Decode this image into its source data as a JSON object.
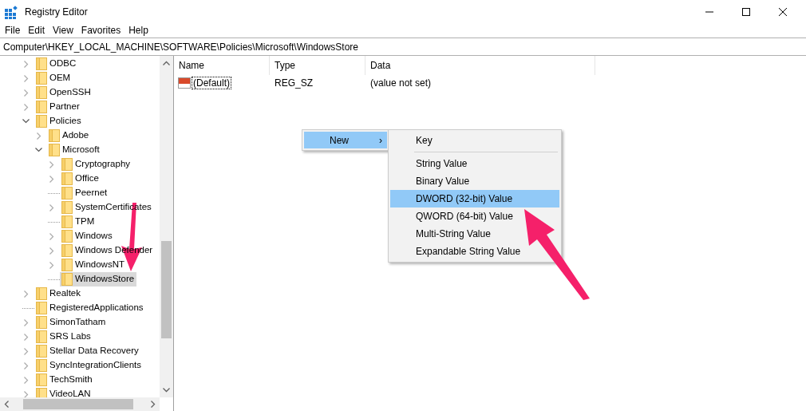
{
  "window": {
    "title": "Registry Editor"
  },
  "menu_bar": [
    "File",
    "Edit",
    "View",
    "Favorites",
    "Help"
  ],
  "address_bar": {
    "value": "Computer\\HKEY_LOCAL_MACHINE\\SOFTWARE\\Policies\\Microsoft\\WindowsStore"
  },
  "tree": [
    {
      "label": "ODBC",
      "has_children": true,
      "expanded": false,
      "selected": false
    },
    {
      "label": "OEM",
      "has_children": true,
      "expanded": false,
      "selected": false
    },
    {
      "label": "OpenSSH",
      "has_children": true,
      "expanded": false,
      "selected": false
    },
    {
      "label": "Partner",
      "has_children": true,
      "expanded": false,
      "selected": false
    },
    {
      "label": "Policies",
      "has_children": true,
      "expanded": true,
      "selected": false,
      "children": [
        {
          "label": "Adobe",
          "has_children": true,
          "expanded": false,
          "selected": false
        },
        {
          "label": "Microsoft",
          "has_children": true,
          "expanded": true,
          "selected": false,
          "children": [
            {
              "label": "Cryptography",
              "has_children": true,
              "expanded": false,
              "selected": false
            },
            {
              "label": "Office",
              "has_children": true,
              "expanded": false,
              "selected": false
            },
            {
              "label": "Peernet",
              "has_children": false,
              "selected": false
            },
            {
              "label": "SystemCertificates",
              "has_children": true,
              "expanded": false,
              "selected": false
            },
            {
              "label": "TPM",
              "has_children": false,
              "selected": false
            },
            {
              "label": "Windows",
              "has_children": true,
              "expanded": false,
              "selected": false
            },
            {
              "label": "Windows Defender",
              "has_children": true,
              "expanded": false,
              "selected": false
            },
            {
              "label": "WindowsNT",
              "has_children": true,
              "expanded": false,
              "selected": false
            },
            {
              "label": "WindowsStore",
              "has_children": false,
              "selected": true
            }
          ]
        }
      ]
    },
    {
      "label": "Realtek",
      "has_children": true,
      "expanded": false,
      "selected": false
    },
    {
      "label": "RegisteredApplications",
      "has_children": false,
      "selected": false
    },
    {
      "label": "SimonTatham",
      "has_children": true,
      "expanded": false,
      "selected": false
    },
    {
      "label": "SRS Labs",
      "has_children": true,
      "expanded": false,
      "selected": false
    },
    {
      "label": "Stellar Data Recovery",
      "has_children": true,
      "expanded": false,
      "selected": false
    },
    {
      "label": "SyncIntegrationClients",
      "has_children": true,
      "expanded": false,
      "selected": false
    },
    {
      "label": "TechSmith",
      "has_children": true,
      "expanded": false,
      "selected": false
    },
    {
      "label": "VideoLAN",
      "has_children": true,
      "expanded": false,
      "selected": false
    }
  ],
  "values_table": {
    "columns": [
      "Name",
      "Type",
      "Data"
    ],
    "rows": [
      {
        "name": "(Default)",
        "type": "REG_SZ",
        "data": "(value not set)"
      }
    ]
  },
  "context_menu": {
    "items": [
      {
        "label": "New",
        "arrow": "›",
        "selected": true
      }
    ]
  },
  "submenu": {
    "items": [
      {
        "kind": "item",
        "label": "Key",
        "selected": false
      },
      {
        "kind": "separator"
      },
      {
        "kind": "item",
        "label": "String Value",
        "selected": false
      },
      {
        "kind": "item",
        "label": "Binary Value",
        "selected": false
      },
      {
        "kind": "item",
        "label": "DWORD (32-bit) Value",
        "selected": true
      },
      {
        "kind": "item",
        "label": "QWORD (64-bit) Value",
        "selected": false
      },
      {
        "kind": "item",
        "label": "Multi-String Value",
        "selected": false
      },
      {
        "kind": "item",
        "label": "Expandable String Value",
        "selected": false
      }
    ]
  }
}
